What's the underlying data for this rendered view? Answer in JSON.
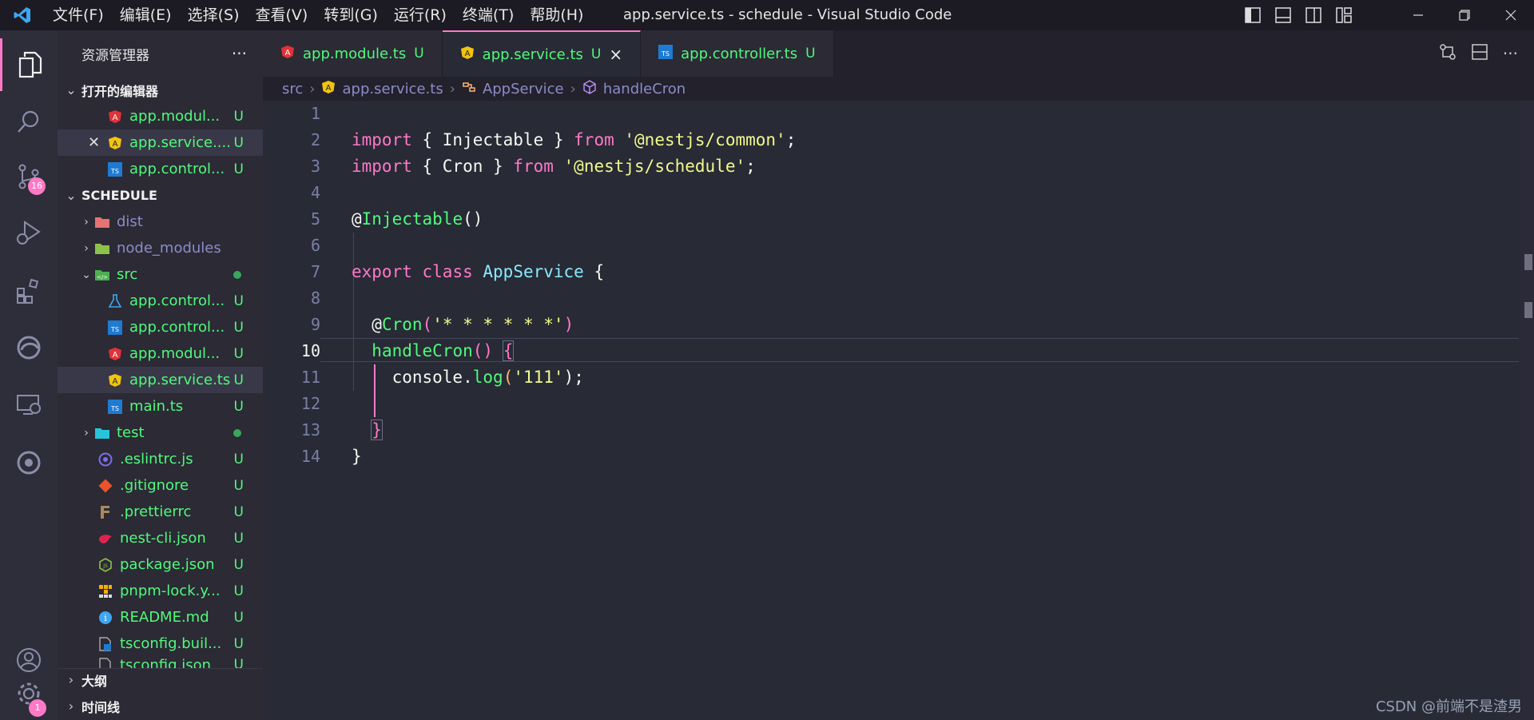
{
  "menu": [
    "文件(F)",
    "编辑(E)",
    "选择(S)",
    "查看(V)",
    "转到(G)",
    "运行(R)",
    "终端(T)",
    "帮助(H)"
  ],
  "window_title": "app.service.ts - schedule - Visual Studio Code",
  "activity": {
    "scm_badge": "16",
    "settings_badge": "1"
  },
  "sidebar": {
    "title": "资源管理器",
    "more": "···",
    "open_editors_title": "打开的编辑器",
    "open_editors": [
      {
        "label": "app.modul...",
        "status": "U",
        "icon": "angular-red-icon"
      },
      {
        "label": "app.service....",
        "status": "U",
        "icon": "angular-yellow-icon"
      },
      {
        "label": "app.control...",
        "status": "U",
        "icon": "typescript-icon"
      }
    ],
    "project_title": "SCHEDULE",
    "tree": [
      {
        "label": "dist",
        "kind": "folder",
        "icon": "folder-dist-icon"
      },
      {
        "label": "node_modules",
        "kind": "folder",
        "icon": "folder-node-icon"
      },
      {
        "label": "src",
        "kind": "folder-open",
        "icon": "folder-src-icon"
      },
      {
        "label": "app.control...",
        "status": "U",
        "icon": "test-flask-icon"
      },
      {
        "label": "app.control...",
        "status": "U",
        "icon": "typescript-icon"
      },
      {
        "label": "app.modul...",
        "status": "U",
        "icon": "angular-red-icon"
      },
      {
        "label": "app.service.ts",
        "status": "U",
        "icon": "angular-yellow-icon"
      },
      {
        "label": "main.ts",
        "status": "U",
        "icon": "typescript-icon"
      },
      {
        "label": "test",
        "kind": "folder",
        "icon": "folder-test-icon"
      },
      {
        "label": ".eslintrc.js",
        "status": "U",
        "icon": "eslint-icon"
      },
      {
        "label": ".gitignore",
        "status": "U",
        "icon": "git-icon"
      },
      {
        "label": ".prettierrc",
        "status": "U",
        "icon": "prettier-icon"
      },
      {
        "label": "nest-cli.json",
        "status": "U",
        "icon": "nest-icon"
      },
      {
        "label": "package.json",
        "status": "U",
        "icon": "node-icon"
      },
      {
        "label": "pnpm-lock.y...",
        "status": "U",
        "icon": "pnpm-icon"
      },
      {
        "label": "README.md",
        "status": "U",
        "icon": "info-icon"
      },
      {
        "label": "tsconfig.buil...",
        "status": "U",
        "icon": "tsconfig-icon"
      },
      {
        "label": "tsconfig.json",
        "status": "U",
        "icon": "tsconfig-icon"
      }
    ],
    "outline_title": "大纲",
    "timeline_title": "时间线"
  },
  "tabs": [
    {
      "label": "app.module.ts",
      "status": "U",
      "icon": "angular-red-icon"
    },
    {
      "label": "app.service.ts",
      "status": "U",
      "icon": "angular-yellow-icon",
      "close": "×"
    },
    {
      "label": "app.controller.ts",
      "status": "U",
      "icon": "typescript-icon"
    }
  ],
  "breadcrumb": [
    "src",
    "app.service.ts",
    "AppService",
    "handleCron"
  ],
  "code": {
    "line_numbers": [
      "1",
      "2",
      "3",
      "4",
      "5",
      "6",
      "7",
      "8",
      "9",
      "10",
      "11",
      "12",
      "13",
      "14"
    ],
    "l2": [
      "import",
      " { Injectable } ",
      "from",
      " ",
      "'@nestjs/common'",
      ";"
    ],
    "l3": [
      "import",
      " { Cron } ",
      "from",
      " ",
      "'@nestjs/schedule'",
      ";"
    ],
    "l5": [
      "@",
      "Injectable",
      "()"
    ],
    "l7": [
      "export",
      " ",
      "class",
      " ",
      "AppService",
      " {"
    ],
    "l9": [
      "@",
      "Cron",
      "(",
      "'* * * * * *'",
      ")"
    ],
    "l10": [
      "handleCron",
      "()",
      " ",
      "{"
    ],
    "l11": [
      "console",
      ".",
      "log",
      "(",
      "'111'",
      ");"
    ],
    "l13": [
      "}"
    ],
    "l14": [
      "}"
    ]
  },
  "watermark": "CSDN @前端不是渣男"
}
